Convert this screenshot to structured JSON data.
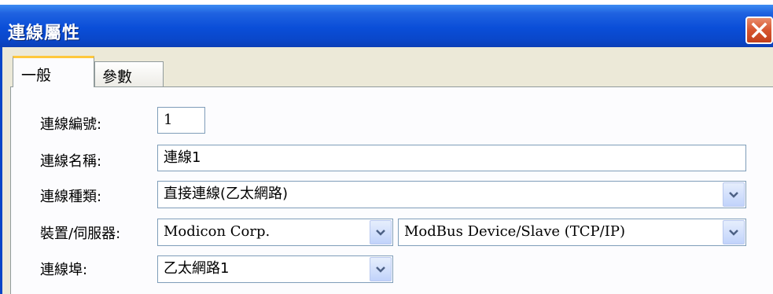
{
  "window": {
    "title": "連線屬性"
  },
  "tabs": [
    {
      "label": "一般"
    },
    {
      "label": "參數"
    }
  ],
  "form": {
    "link_no_label": "連線編號:",
    "link_no_value": "1",
    "link_name_label": "連線名稱:",
    "link_name_value": "連線1",
    "link_type_label": "連線種類:",
    "link_type_value": "直接連線(乙太網路)",
    "device_label": "裝置/伺服器:",
    "device_vendor_value": "Modicon Corp.",
    "device_model_value": "ModBus Device/Slave (TCP/IP)",
    "link_port_label": "連線埠:",
    "link_port_value": "乙太網路1"
  },
  "icons": [
    "close-icon",
    "chevron-down-icon"
  ],
  "colors": {
    "titlebar": "#0a4ed8",
    "close": "#d6552f",
    "tab_highlight": "#ffc83c",
    "arrow": "#4d6185"
  }
}
